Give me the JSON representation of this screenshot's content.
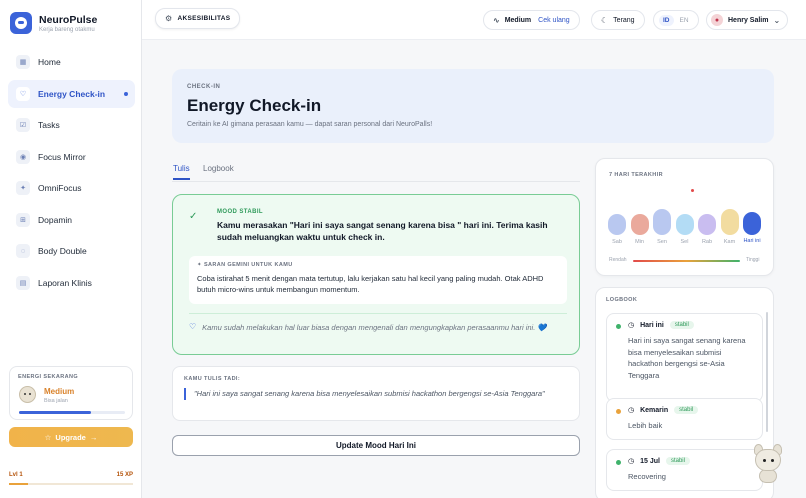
{
  "brand": {
    "name": "NeuroPulse",
    "tagline": "Kerja bareng otakmu"
  },
  "sidebar": {
    "items": [
      {
        "label": "Home",
        "icon": "grid-icon"
      },
      {
        "label": "Energy Check-in",
        "icon": "heart-icon",
        "active": true
      },
      {
        "label": "Tasks",
        "icon": "checkbox-icon"
      },
      {
        "label": "Focus Mirror",
        "icon": "eye-icon"
      },
      {
        "label": "OmniFocus",
        "icon": "sparkle-icon"
      },
      {
        "label": "Dopamin",
        "icon": "gift-icon"
      },
      {
        "label": "Body Double",
        "icon": "chat-icon"
      },
      {
        "label": "Laporan Klinis",
        "icon": "document-icon"
      }
    ],
    "energy": {
      "title": "ENERGI SEKARANG",
      "level": "Medium",
      "sub": "Bisa jalan",
      "level_fraction": 0.68
    },
    "upgrade_label": "Upgrade",
    "level_label": "Lvl 1",
    "xp_label": "15 XP",
    "xp_fraction": 0.15
  },
  "topbar": {
    "accessibility_label": "AKSESIBILITAS",
    "mood_label": "Medium",
    "recheck_label": "Cek ulang",
    "theme_label": "Terang",
    "lang_options": [
      "ID",
      "EN"
    ],
    "lang_selected": "ID",
    "user_name": "Henry Salim"
  },
  "hero": {
    "label": "CHECK-IN",
    "title": "Energy Check-in",
    "subtitle": "Ceritain ke AI gimana perasaan kamu — dapat saran personal dari NeuroPalls!"
  },
  "tabs": [
    "Tulis",
    "Logbook"
  ],
  "mood": {
    "tag": "MOOD STABIL",
    "text": "Kamu merasakan \"Hari ini saya sangat senang karena bisa \" hari ini. Terima kasih sudah meluangkan waktu untuk check in.",
    "advice_label": "SARAN GEMINI UNTUK KAMU",
    "advice_text": "Coba istirahat 5 menit dengan mata tertutup, lalu kerjakan satu hal kecil yang paling mudah. Otak ADHD butuh micro-wins untuk membangun momentum.",
    "encourage_text": "Kamu sudah melakukan hal luar biasa dengan mengenali dan mengungkapkan perasaanmu hari ini. 💙"
  },
  "wrote": {
    "label": "KAMU TULIS TADI:",
    "text": "\"Hari ini saya sangat senang karena bisa menyelesaikan submisi hackathon bergengsi se-Asia Tenggara\""
  },
  "update_label": "Update Mood Hari Ini",
  "week": {
    "label": "7 HARI TERAKHIR",
    "low_label": "Rendah",
    "high_label": "Tinggi"
  },
  "chart_data": {
    "type": "bar",
    "categories": [
      "Sab",
      "Min",
      "Sen",
      "Sel",
      "Rab",
      "Kam",
      "Hari ini"
    ],
    "values": [
      2,
      2,
      3,
      2,
      2,
      3,
      3
    ],
    "colors": [
      "#b9c8f0",
      "#eaa99c",
      "#b9c8f0",
      "#b3dcf5",
      "#c9bdf0",
      "#f2dca0",
      "#3b63d9"
    ]
  },
  "logbook": {
    "label": "LOGBOOK",
    "entries": [
      {
        "day": "Hari ini",
        "badge": "stabil",
        "text": "Hari ini saya sangat senang karena bisa menyelesaikan submisi hackathon bergengsi se-Asia Tenggara",
        "dot": "#3fb26b"
      },
      {
        "day": "Kemarin",
        "badge": "stabil",
        "text": "Lebih baik",
        "dot": "#e9a23b"
      },
      {
        "day": "15 Jul",
        "badge": "stabil",
        "text": "Recovering",
        "dot": "#3fb26b"
      }
    ]
  }
}
